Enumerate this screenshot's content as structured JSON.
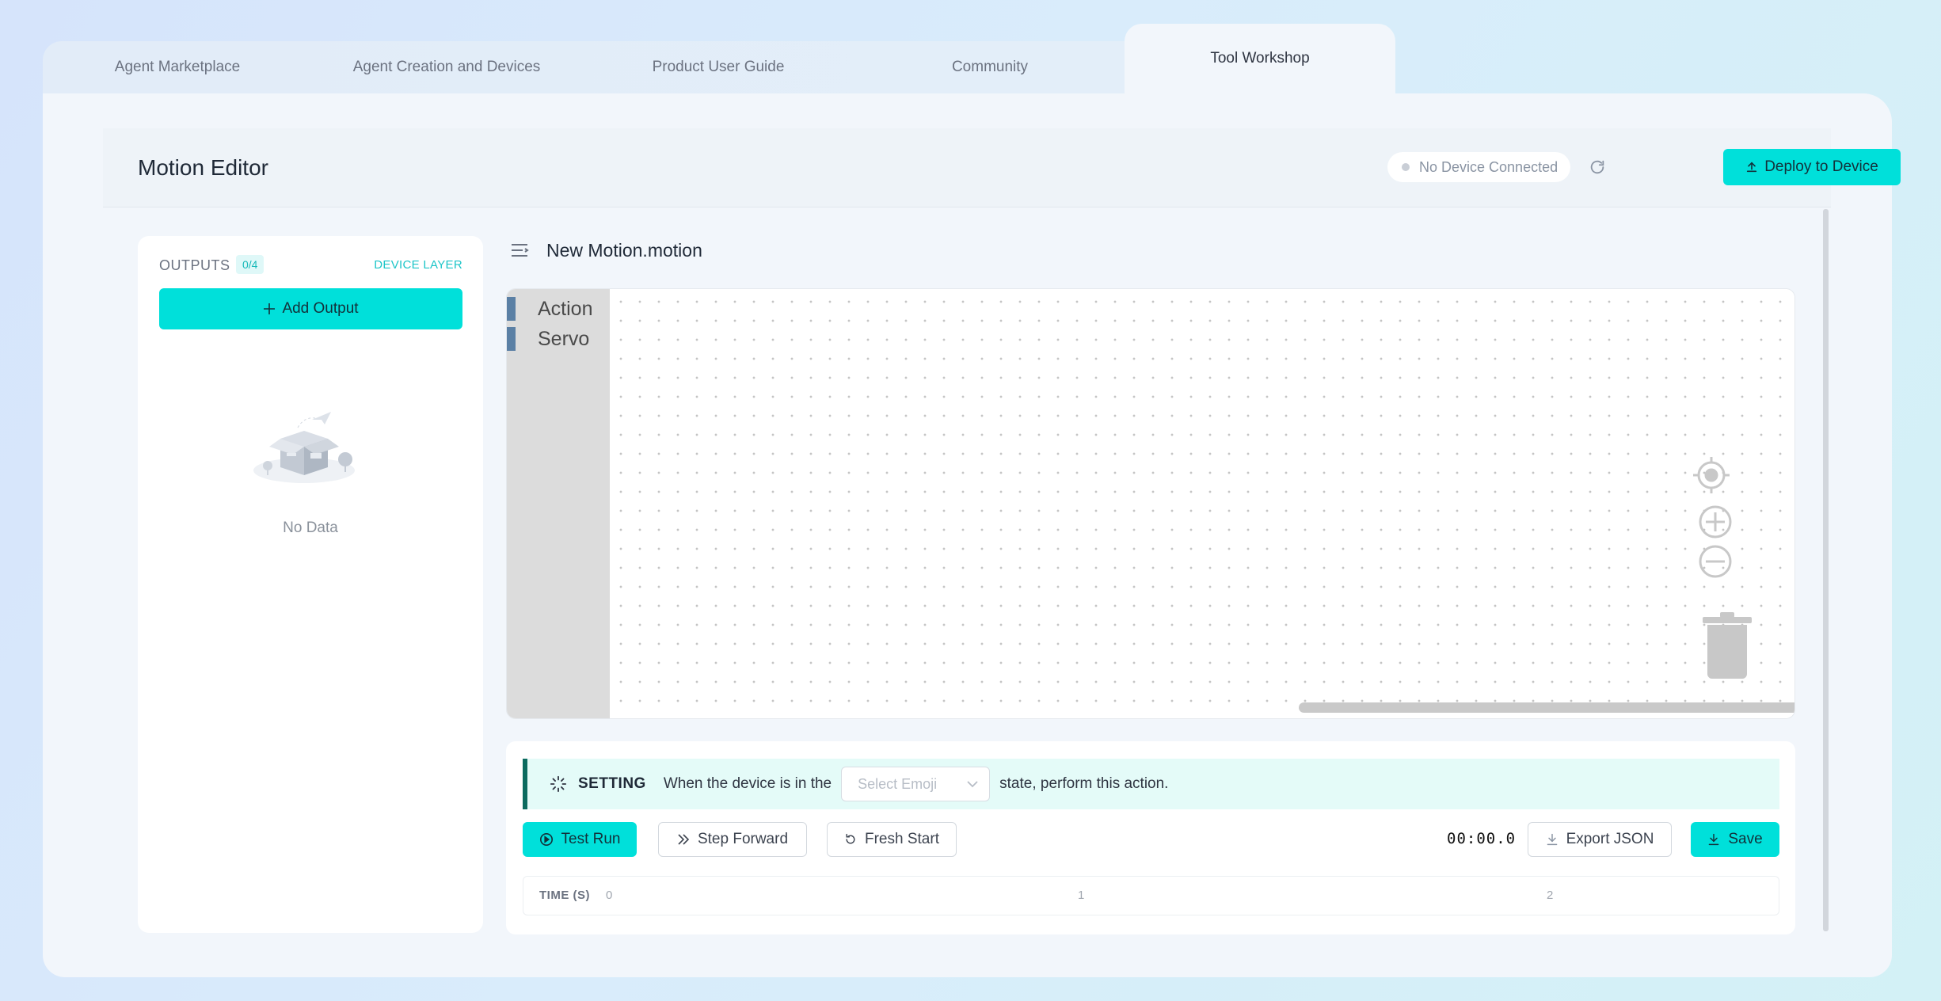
{
  "tabs": [
    {
      "label": "Agent Marketplace",
      "active": false
    },
    {
      "label": "Agent Creation and Devices",
      "active": false
    },
    {
      "label": "Product User Guide",
      "active": false
    },
    {
      "label": "Community",
      "active": false
    },
    {
      "label": "Tool Workshop",
      "active": true
    }
  ],
  "header": {
    "title": "Motion Editor",
    "device_status": "No Device Connected",
    "refresh_icon": "refresh-icon",
    "deploy_label": "Deploy to Device",
    "deploy_icon": "upload-icon"
  },
  "outputs": {
    "label": "OUTPUTS",
    "count": "0/4",
    "device_layer": "DEVICE LAYER",
    "add_label": "Add Output",
    "empty_text": "No Data"
  },
  "editor": {
    "file_name": "New Motion.motion",
    "menu_icon": "menu-icon",
    "categories": [
      {
        "label": "Action",
        "color": "#5b80a5"
      },
      {
        "label": "Servo",
        "color": "#5b80a5"
      }
    ]
  },
  "setting": {
    "title": "SETTING",
    "text_before": "When the device is in the",
    "emoji_placeholder": "Select Emoji",
    "text_after": "state, perform this action."
  },
  "controls": {
    "test_run": "Test Run",
    "step_forward": "Step Forward",
    "fresh_start": "Fresh Start",
    "time": "00:00.0",
    "export_json": "Export JSON",
    "save": "Save"
  },
  "timeline": {
    "label": "TIME (S)",
    "ticks": [
      "0",
      "1",
      "2"
    ]
  },
  "colors": {
    "accent": "#00e0da",
    "setting_border": "#0b6b5f",
    "category_bar": "#5b80a5"
  }
}
